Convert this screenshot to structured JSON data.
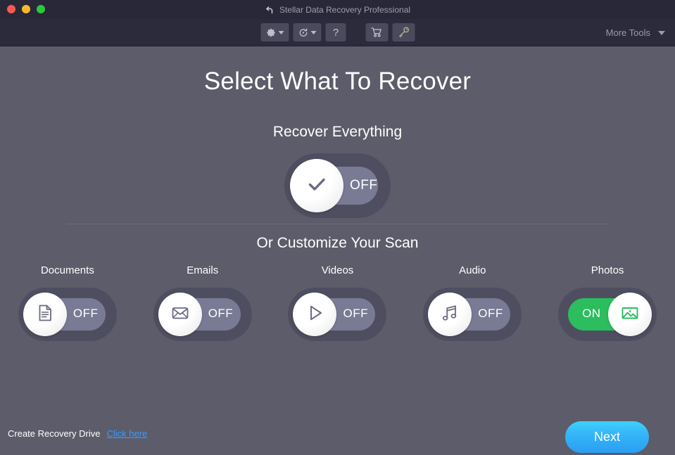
{
  "window": {
    "title": "Stellar Data Recovery Professional",
    "title_icon": "undo-arrow-icon",
    "traffic_lights": [
      {
        "name": "close",
        "color": "#f9594f"
      },
      {
        "name": "minimize",
        "color": "#f9b82e"
      },
      {
        "name": "zoom",
        "color": "#2cc93d"
      }
    ]
  },
  "toolbar": {
    "buttons": [
      {
        "id": "settings",
        "icon": "gear-icon",
        "has_caret": true
      },
      {
        "id": "history",
        "icon": "recover-clock-icon",
        "has_caret": true
      },
      {
        "id": "help",
        "icon": "question-mark-icon",
        "label": "?",
        "has_caret": false
      },
      {
        "id": "buy",
        "icon": "shopping-cart-icon",
        "has_caret": false
      },
      {
        "id": "activate",
        "icon": "key-icon",
        "has_caret": false
      }
    ],
    "more_tools_label": "More Tools"
  },
  "main": {
    "heading": "Select What To Recover",
    "subheading": "Recover Everything",
    "customize_heading": "Or Customize Your Scan",
    "master_toggle": {
      "name": "recover-everything",
      "state": "OFF",
      "icon": "checkmark-icon"
    },
    "categories": [
      {
        "name": "documents",
        "label": "Documents",
        "state": "OFF",
        "icon": "document-icon"
      },
      {
        "name": "emails",
        "label": "Emails",
        "state": "OFF",
        "icon": "envelope-icon"
      },
      {
        "name": "videos",
        "label": "Videos",
        "state": "OFF",
        "icon": "play-triangle-icon"
      },
      {
        "name": "audio",
        "label": "Audio",
        "state": "OFF",
        "icon": "music-note-icon"
      },
      {
        "name": "photos",
        "label": "Photos",
        "state": "ON",
        "icon": "photo-image-icon"
      }
    ]
  },
  "footer": {
    "recovery_drive_text": "Create Recovery Drive",
    "click_here_label": "Click here",
    "next_label": "Next"
  },
  "colors": {
    "window_chrome": "#282838",
    "toolbar": "#2b2b3c",
    "background": "#5c5c6a",
    "toggle_track_outer": "#4e4e60",
    "toggle_track_inner": "#797a94",
    "toggle_on_green": "#2bbd5e",
    "link_blue": "#3d9bfd",
    "next_button_blue": "#35b6f7",
    "icon_stroke": "#6a6a85"
  }
}
